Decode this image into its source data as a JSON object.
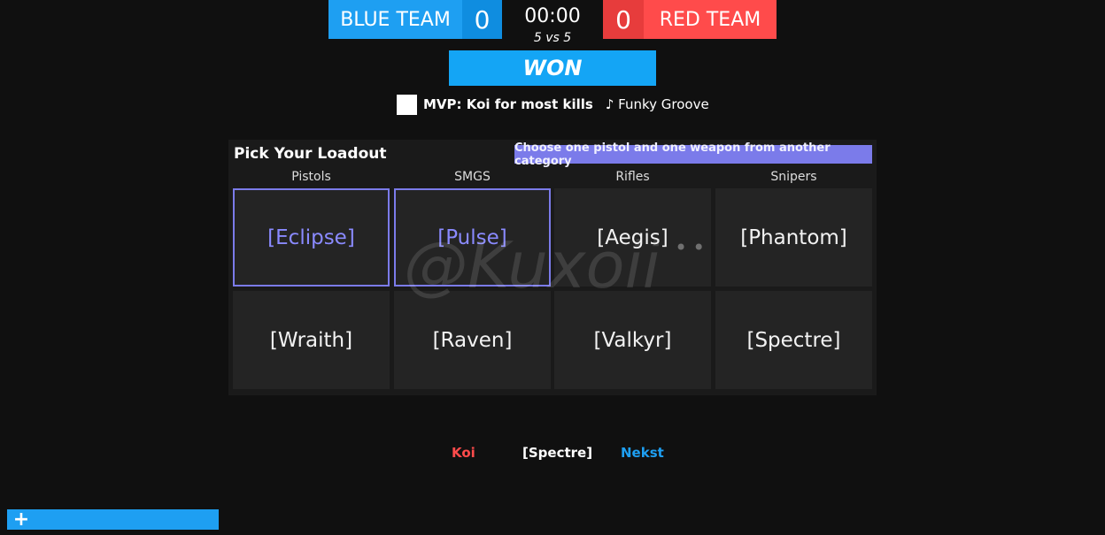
{
  "scoreboard": {
    "blue_team": "BLUE TEAM",
    "blue_score": "0",
    "timer": "00:00",
    "mode": "5 vs 5",
    "red_score": "0",
    "red_team": "RED TEAM",
    "result": "WON"
  },
  "mvp": {
    "text": "MVP: Koi for most kills",
    "song": "♪ Funky Groove"
  },
  "loadout": {
    "title": "Pick Your Loadout",
    "hint": "Choose one pistol and one weapon from another category",
    "categories": [
      "Pistols",
      "SMGS",
      "Rifles",
      "Snipers"
    ],
    "weapons": [
      [
        "[Eclipse]",
        "[Pulse]",
        "[Aegis]",
        "[Phantom]"
      ],
      [
        "[Wraith]",
        "[Raven]",
        "[Valkyr]",
        "[Spectre]"
      ]
    ],
    "selected": [
      "[Eclipse]",
      "[Pulse]"
    ]
  },
  "watermark": "@Kuxoii",
  "killfeed": {
    "killer": "Koi",
    "weapon": "[Spectre]",
    "victim": "Nekst"
  },
  "colors": {
    "blue": "#1e9ff2",
    "red": "#ff4b4b",
    "accent": "#7b7bea"
  },
  "icons": {
    "add": "plus-icon"
  }
}
